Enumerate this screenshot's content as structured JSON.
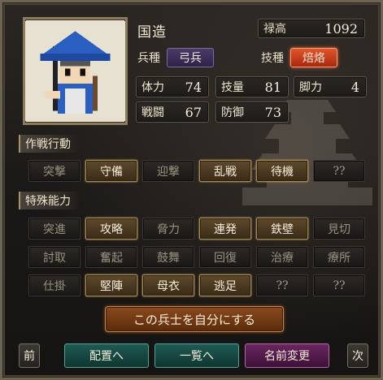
{
  "unit": {
    "name": "国造",
    "salary": {
      "label": "禄高",
      "value": "1092"
    },
    "troop_type": {
      "label": "兵種",
      "value": "弓兵"
    },
    "skill_type": {
      "label": "技種",
      "value": "焙烙"
    },
    "stats": [
      {
        "key": "hp",
        "label": "体力",
        "value": "74"
      },
      {
        "key": "skill",
        "label": "技量",
        "value": "81"
      },
      {
        "key": "leg",
        "label": "脚力",
        "value": "4"
      },
      {
        "key": "combat",
        "label": "戦闘",
        "value": "67"
      },
      {
        "key": "defense",
        "label": "防御",
        "value": "73"
      }
    ]
  },
  "tactics": {
    "title": "作戦行動",
    "items": [
      {
        "label": "突撃",
        "active": false
      },
      {
        "label": "守備",
        "active": true
      },
      {
        "label": "迎撃",
        "active": false
      },
      {
        "label": "乱戦",
        "active": true
      },
      {
        "label": "待機",
        "active": true
      },
      {
        "label": "??",
        "active": false
      }
    ]
  },
  "abilities": {
    "title": "特殊能力",
    "items": [
      {
        "label": "突進",
        "active": false
      },
      {
        "label": "攻略",
        "active": true
      },
      {
        "label": "脅力",
        "active": false
      },
      {
        "label": "連発",
        "active": true
      },
      {
        "label": "鉄壁",
        "active": true
      },
      {
        "label": "見切",
        "active": false
      },
      {
        "label": "討取",
        "active": false
      },
      {
        "label": "奮起",
        "active": false
      },
      {
        "label": "鼓舞",
        "active": false
      },
      {
        "label": "回復",
        "active": false
      },
      {
        "label": "治療",
        "active": false
      },
      {
        "label": "療所",
        "active": false
      },
      {
        "label": "仕掛",
        "active": false
      },
      {
        "label": "堅陣",
        "active": true
      },
      {
        "label": "母衣",
        "active": true
      },
      {
        "label": "逃足",
        "active": true
      },
      {
        "label": "??",
        "active": false
      },
      {
        "label": "??",
        "active": false
      }
    ]
  },
  "actions": {
    "claim": "この兵士を自分にする",
    "prev": "前",
    "deploy": "配置へ",
    "list": "一覧へ",
    "rename": "名前変更",
    "next": "次"
  },
  "colors": {
    "active_button": "#5e4a2c",
    "inactive_button": "#2c2926",
    "troop_type": "#4a3a6a",
    "skill_type": "#e0562a",
    "teal_button": "#1f5a54",
    "purple_button": "#6a2660",
    "claim_button": "#8a4a1c"
  }
}
